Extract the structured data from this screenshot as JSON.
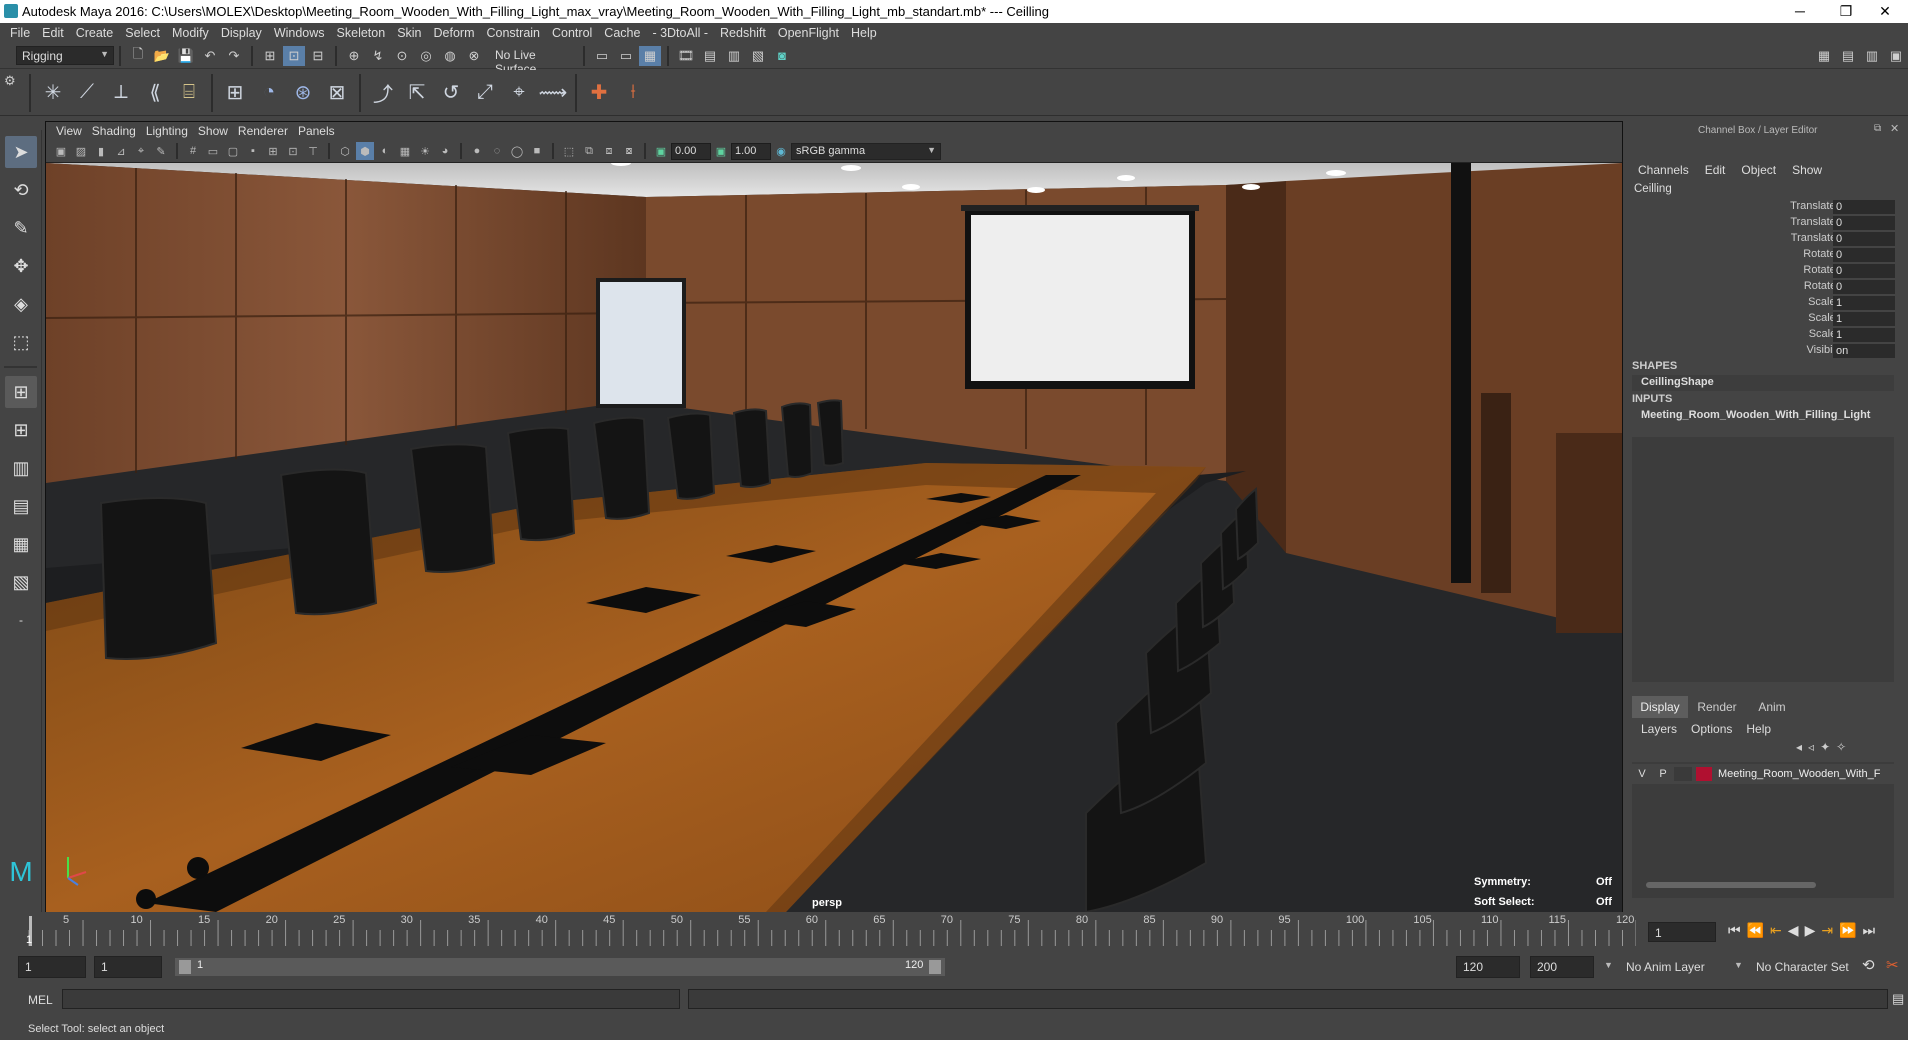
{
  "window": {
    "title": "Autodesk Maya 2016: C:\\Users\\MOLEX\\Desktop\\Meeting_Room_Wooden_With_Filling_Light_max_vray\\Meeting_Room_Wooden_With_Filling_Light_mb_standart.mb*   ---   Ceilling",
    "minimize": "─",
    "restore": "❐",
    "close": "✕"
  },
  "menubar": [
    "File",
    "Edit",
    "Create",
    "Select",
    "Modify",
    "Display",
    "Windows",
    "Skeleton",
    "Skin",
    "Deform",
    "Constrain",
    "Control",
    "Cache",
    "- 3DtoAll -",
    "Redshift",
    "OpenFlight",
    "Help"
  ],
  "statusline": {
    "mode": "Rigging",
    "live_surface": "No Live Surface"
  },
  "viewport": {
    "menu": [
      "View",
      "Shading",
      "Lighting",
      "Show",
      "Renderer",
      "Panels"
    ],
    "near_value": "0.00",
    "far_value": "1.00",
    "color_space": "sRGB gamma",
    "camera_label": "persp",
    "hud": {
      "symmetry_label": "Symmetry:",
      "symmetry_value": "Off",
      "soft_select_label": "Soft Select:",
      "soft_select_value": "Off"
    }
  },
  "channel_box": {
    "header": "Channel Box / Layer Editor",
    "menu": [
      "Channels",
      "Edit",
      "Object",
      "Show"
    ],
    "object_name": "Ceilling",
    "attributes": [
      {
        "label": "Translate X",
        "value": "0"
      },
      {
        "label": "Translate Y",
        "value": "0"
      },
      {
        "label": "Translate Z",
        "value": "0"
      },
      {
        "label": "Rotate X",
        "value": "0"
      },
      {
        "label": "Rotate Y",
        "value": "0"
      },
      {
        "label": "Rotate Z",
        "value": "0"
      },
      {
        "label": "Scale X",
        "value": "1"
      },
      {
        "label": "Scale Y",
        "value": "1"
      },
      {
        "label": "Scale Z",
        "value": "1"
      },
      {
        "label": "Visibility",
        "value": "on"
      }
    ],
    "shapes_label": "SHAPES",
    "shape_name": "CeillingShape",
    "inputs_label": "INPUTS",
    "input_name": "Meeting_Room_Wooden_With_Filling_Light"
  },
  "layer_editor": {
    "tabs": [
      "Display",
      "Render",
      "Anim"
    ],
    "active_tab": "Display",
    "menu": [
      "Layers",
      "Options",
      "Help"
    ],
    "layer": {
      "v": "V",
      "p": "P",
      "name": "Meeting_Room_Wooden_With_F",
      "color": "#b01030"
    }
  },
  "timeline": {
    "ticks": [
      "5",
      "10",
      "15",
      "20",
      "25",
      "30",
      "35",
      "40",
      "45",
      "50",
      "55",
      "60",
      "65",
      "70",
      "75",
      "80",
      "85",
      "90",
      "95",
      "100",
      "105",
      "110",
      "115",
      "120"
    ],
    "start_tick": "1",
    "current_frame": "1"
  },
  "range": {
    "start": "1",
    "playback_start": "1",
    "slider_start": "1",
    "slider_end": "120",
    "playback_end": "120",
    "end": "200",
    "anim_layer": "No Anim Layer",
    "character_set": "No Character Set"
  },
  "command_line": {
    "label": "MEL"
  },
  "help_line": {
    "text": "Select Tool: select an object"
  }
}
